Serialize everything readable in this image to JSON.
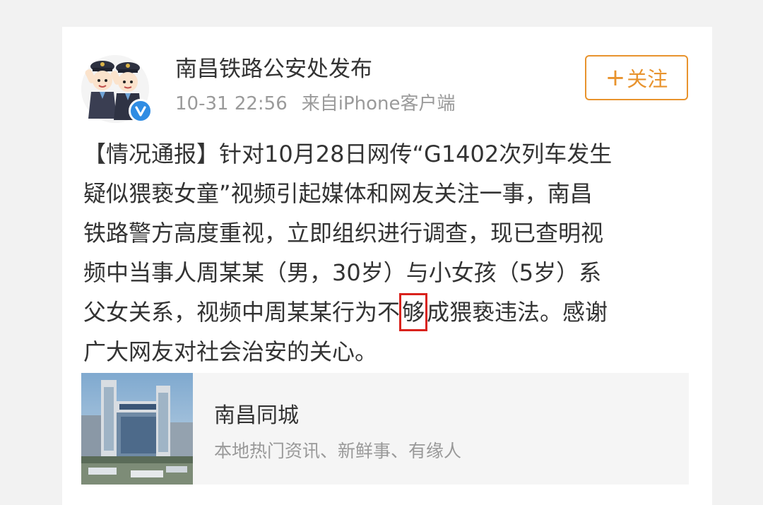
{
  "colors": {
    "background": "#f2f2f2",
    "card": "#ffffff",
    "accent_orange": "#e8932d",
    "verified_blue": "#2f8ce3",
    "highlight_red": "#d9221c",
    "text_primary": "#333333",
    "text_secondary": "#9a9a9a"
  },
  "header": {
    "avatar_icon": "police-mascots-icon",
    "verified_icon": "verified-v-badge-icon",
    "username": "南昌铁路公安处发布",
    "timestamp": "10-31 22:56",
    "source": "来自iPhone客户端",
    "follow_plus": "+",
    "follow_label": "关注"
  },
  "post": {
    "lines": [
      "【情况通报】针对10月28日网传“G1402次列车发生",
      "疑似猥亵女童”视频引起媒体和网友关注一事，南昌",
      "铁路警方高度重视，立即组织进行调查，现已查明视",
      "频中当事人周某某（男，30岁）与小女孩（5岁）系"
    ],
    "line5_before": "父女关系，视频中周某某行为不",
    "line5_highlighted": "够",
    "line5_after": "成猥亵违法。感谢",
    "line6": "广大网友对社会治安的关心。"
  },
  "link_card": {
    "thumbnail_icon": "train-station-photo",
    "title": "南昌同城",
    "description": "本地热门资讯、新鲜事、有缘人"
  }
}
